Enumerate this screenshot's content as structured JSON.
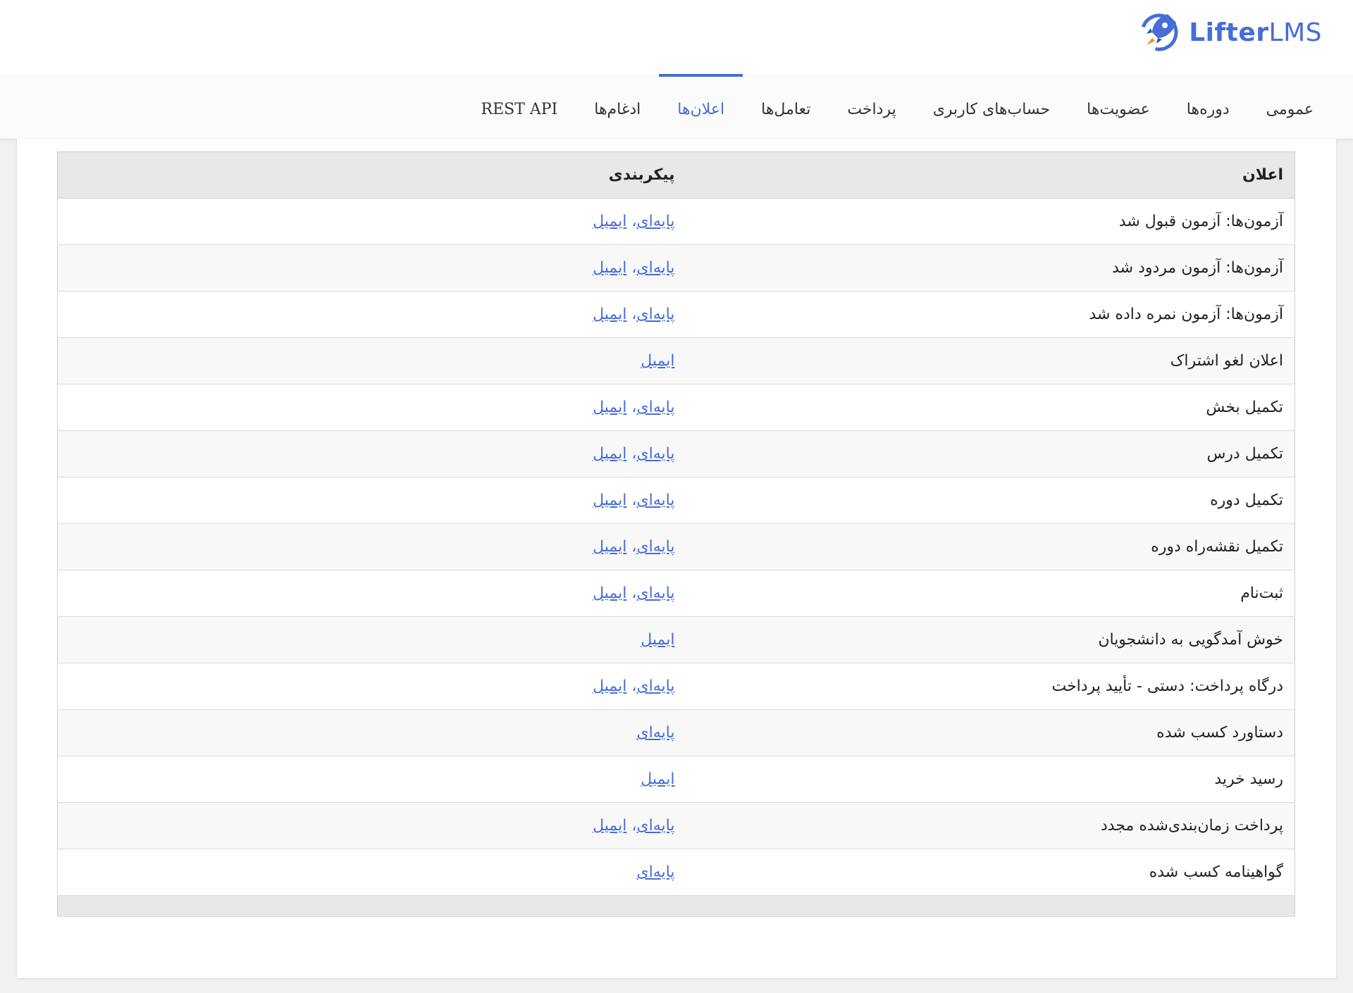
{
  "logo": {
    "brand_main": "Lifter",
    "brand_suffix": "LMS"
  },
  "colors": {
    "accent": "#466dd8",
    "header_bg": "#e8e8e8",
    "page_bg": "#f1f1f1"
  },
  "nav": {
    "tabs": [
      {
        "label": "عمومی",
        "active": false
      },
      {
        "label": "دوره‌ها",
        "active": false
      },
      {
        "label": "عضویت‌ها",
        "active": false
      },
      {
        "label": "حساب‌های کاربری",
        "active": false
      },
      {
        "label": "پرداخت",
        "active": false
      },
      {
        "label": "تعامل‌ها",
        "active": false
      },
      {
        "label": "اعلان‌ها",
        "active": true
      },
      {
        "label": "ادغام‌ها",
        "active": false
      },
      {
        "label": "REST API",
        "active": false
      }
    ]
  },
  "table": {
    "headers": {
      "notification": "اعلان",
      "configuration": "پیکربندی"
    },
    "rows": [
      {
        "name": "آزمون‌ها: آزمون قبول شد",
        "links": [
          "پایه‌ای",
          "ایمیل"
        ]
      },
      {
        "name": "آزمون‌ها: آزمون مردود شد",
        "links": [
          "پایه‌ای",
          "ایمیل"
        ]
      },
      {
        "name": "آزمون‌ها: آزمون نمره داده شد",
        "links": [
          "پایه‌ای",
          "ایمیل"
        ]
      },
      {
        "name": "اعلان لغو اشتراک",
        "links": [
          "ایمیل"
        ]
      },
      {
        "name": "تکمیل بخش",
        "links": [
          "پایه‌ای",
          "ایمیل"
        ]
      },
      {
        "name": "تکمیل درس",
        "links": [
          "پایه‌ای",
          "ایمیل"
        ]
      },
      {
        "name": "تکمیل دوره",
        "links": [
          "پایه‌ای",
          "ایمیل"
        ]
      },
      {
        "name": "تکمیل نقشه‌راه دوره",
        "links": [
          "پایه‌ای",
          "ایمیل"
        ]
      },
      {
        "name": "ثبت‌نام",
        "links": [
          "پایه‌ای",
          "ایمیل"
        ]
      },
      {
        "name": "خوش آمدگویی به دانشجویان",
        "links": [
          "ایمیل"
        ]
      },
      {
        "name": "درگاه پرداخت: دستی - تأیید پرداخت",
        "links": [
          "پایه‌ای",
          "ایمیل"
        ]
      },
      {
        "name": "دستاورد کسب شده",
        "links": [
          "پایه‌ای"
        ]
      },
      {
        "name": "رسید خرید",
        "links": [
          "ایمیل"
        ]
      },
      {
        "name": "پرداخت زمان‌بندی‌شده مجدد",
        "links": [
          "پایه‌ای",
          "ایمیل"
        ]
      },
      {
        "name": "گواهینامه کسب شده",
        "links": [
          "پایه‌ای"
        ]
      }
    ]
  }
}
